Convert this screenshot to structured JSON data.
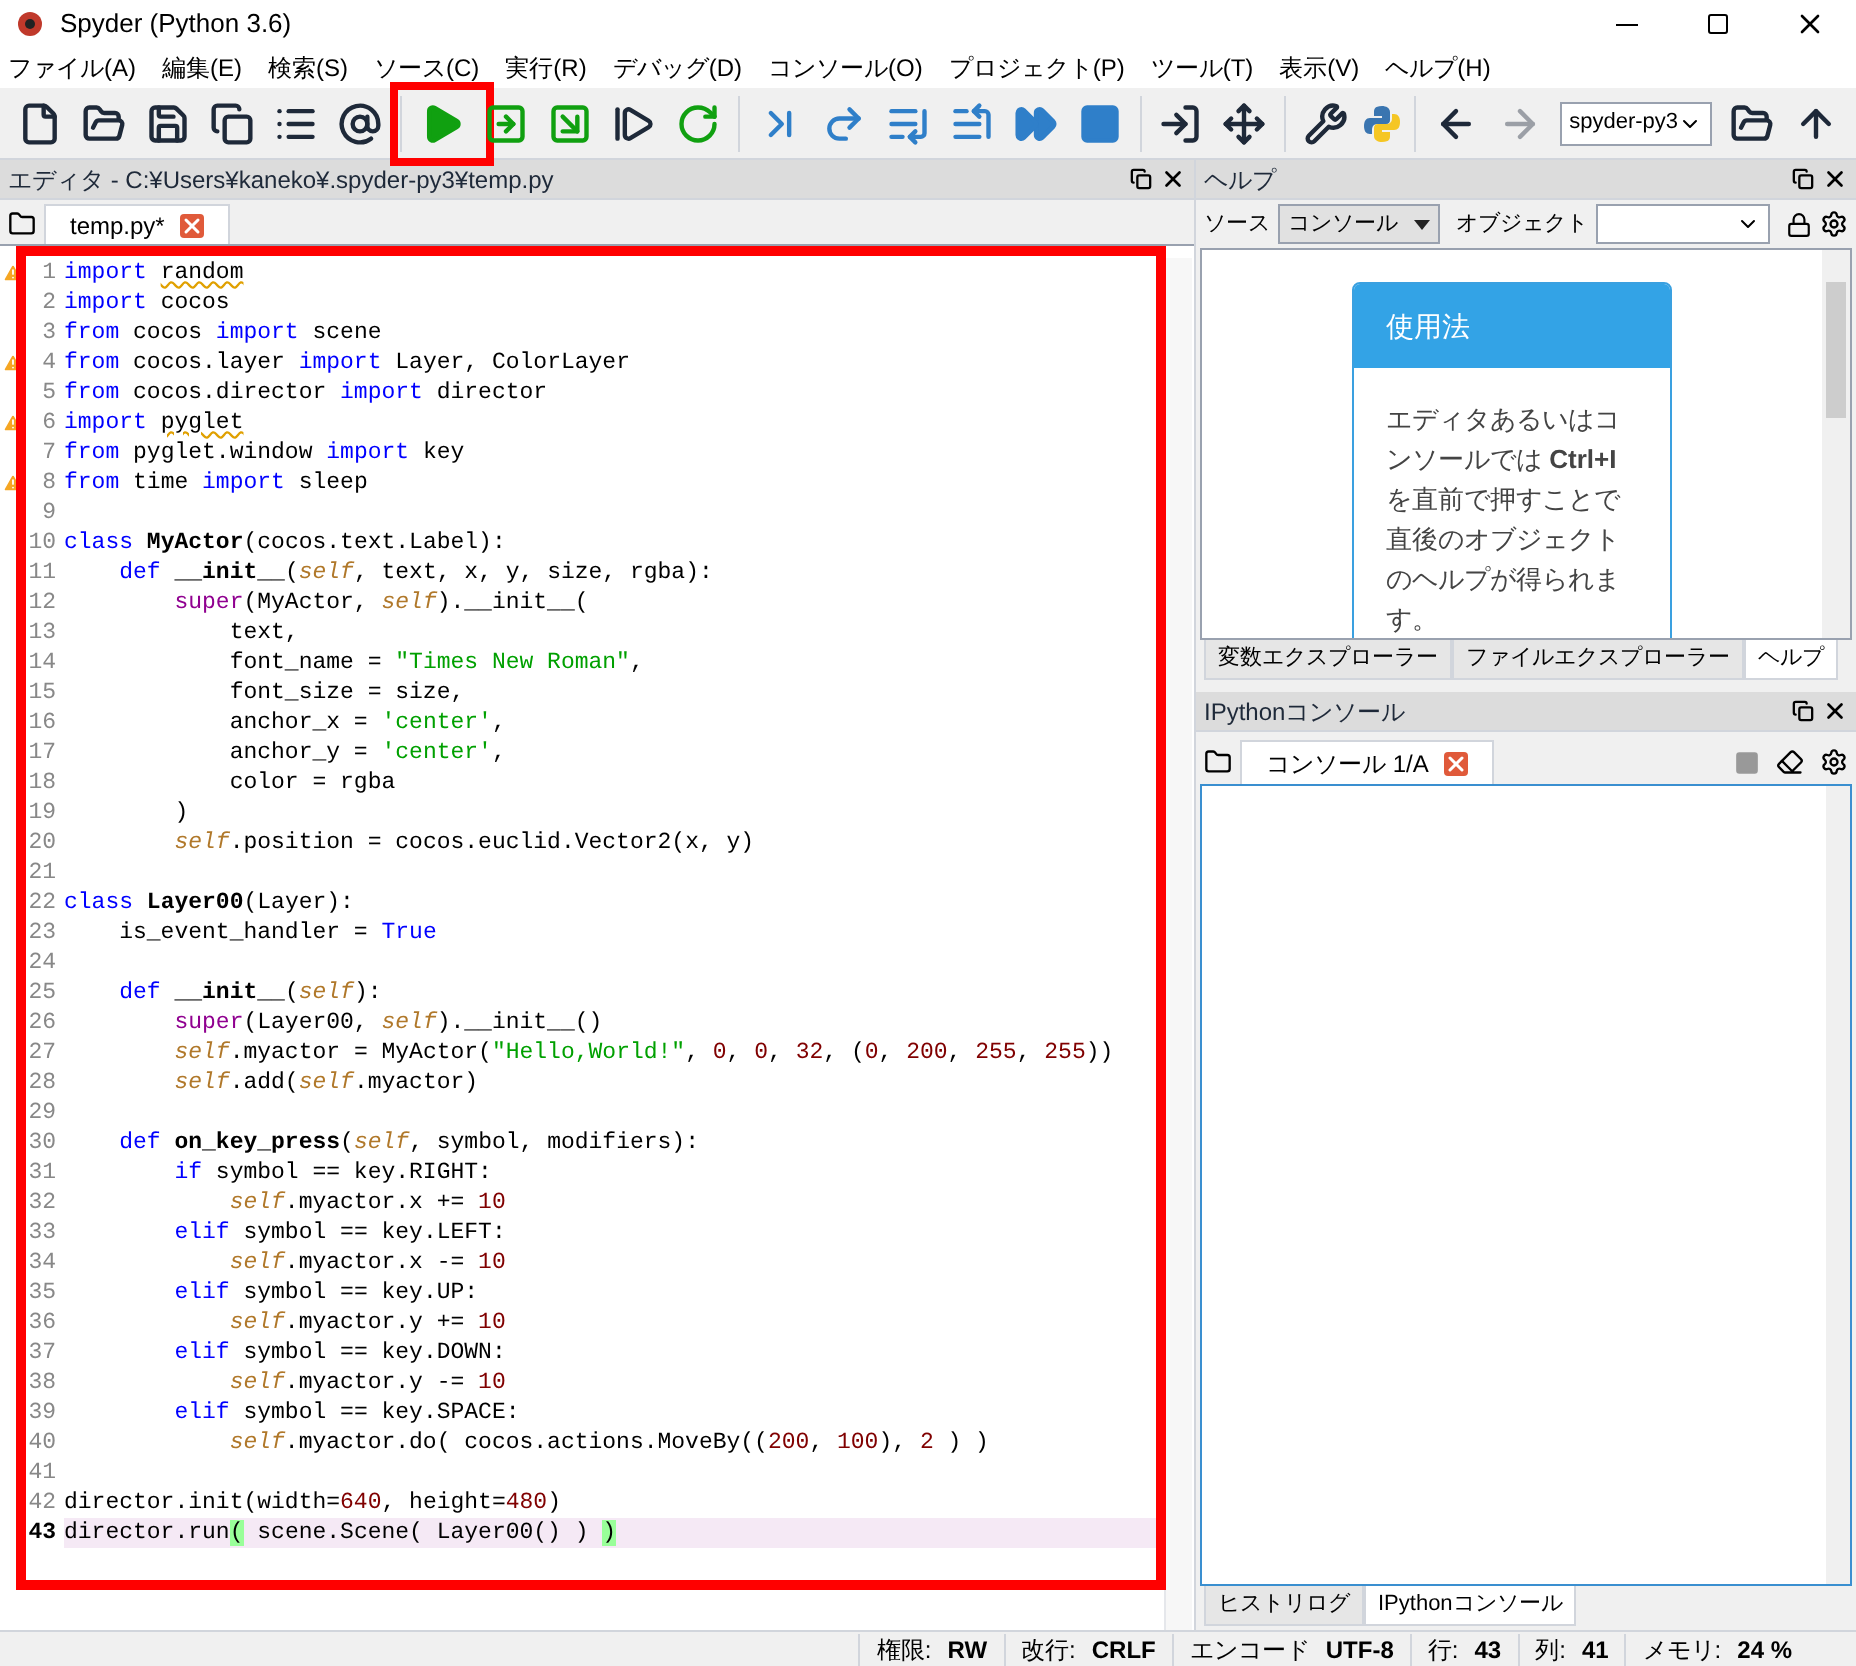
{
  "window": {
    "title": "Spyder (Python 3.6)"
  },
  "menu": [
    "ファイル(A)",
    "編集(E)",
    "検索(S)",
    "ソース(C)",
    "実行(R)",
    "デバッグ(D)",
    "コンソール(O)",
    "プロジェクト(P)",
    "ツール(T)",
    "表示(V)",
    "ヘルプ(H)"
  ],
  "toolbar": [
    {
      "kind": "new"
    },
    {
      "kind": "open"
    },
    {
      "kind": "save"
    },
    {
      "kind": "saveall"
    },
    {
      "kind": "outline"
    },
    {
      "kind": "at"
    },
    {
      "kind": "separator"
    },
    {
      "kind": "run",
      "highlighted": true
    },
    {
      "kind": "runcell"
    },
    {
      "kind": "runcelladvance"
    },
    {
      "kind": "runselection"
    },
    {
      "kind": "rerun"
    },
    {
      "kind": "separator"
    },
    {
      "kind": "debug"
    },
    {
      "kind": "step"
    },
    {
      "kind": "stepinto"
    },
    {
      "kind": "stepreturn"
    },
    {
      "kind": "continue"
    },
    {
      "kind": "stop"
    },
    {
      "kind": "separator"
    },
    {
      "kind": "maximize"
    },
    {
      "kind": "fullscreen"
    },
    {
      "kind": "separator"
    },
    {
      "kind": "preferences"
    },
    {
      "kind": "python"
    },
    {
      "kind": "separator"
    },
    {
      "kind": "back"
    },
    {
      "kind": "forward",
      "disabled": true
    },
    {
      "kind": "path",
      "value": "spyder-py3"
    },
    {
      "kind": "browse"
    },
    {
      "kind": "up"
    }
  ],
  "editor": {
    "title": "エディタ - C:¥Users¥kaneko¥.spyder-py3¥temp.py",
    "highlighted": true,
    "tabs": [
      {
        "label": "temp.py*",
        "selected": true
      }
    ],
    "lines": [
      {
        "n": "1",
        "warning": true,
        "tokens": [
          {
            "kind": "keyword",
            "text": "import "
          },
          {
            "kind": "unused",
            "text": "random"
          }
        ]
      },
      {
        "n": "2",
        "tokens": [
          {
            "kind": "keyword",
            "text": "import"
          },
          {
            "kind": "plain",
            "text": " cocos"
          }
        ]
      },
      {
        "n": "3",
        "tokens": [
          {
            "kind": "keyword",
            "text": "from"
          },
          {
            "kind": "plain",
            "text": " cocos "
          },
          {
            "kind": "keyword",
            "text": "import"
          },
          {
            "kind": "plain",
            "text": " scene"
          }
        ]
      },
      {
        "n": "4",
        "warning": true,
        "tokens": [
          {
            "kind": "keyword",
            "text": "from"
          },
          {
            "kind": "plain",
            "text": " cocos.layer "
          },
          {
            "kind": "keyword",
            "text": "import"
          },
          {
            "kind": "plain",
            "text": " Layer, ColorLayer"
          }
        ]
      },
      {
        "n": "5",
        "tokens": [
          {
            "kind": "keyword",
            "text": "from"
          },
          {
            "kind": "plain",
            "text": " cocos.director "
          },
          {
            "kind": "keyword",
            "text": "import"
          },
          {
            "kind": "plain",
            "text": " director"
          }
        ]
      },
      {
        "n": "6",
        "warning": true,
        "tokens": [
          {
            "kind": "keyword",
            "text": "import "
          },
          {
            "kind": "unused",
            "text": "pyglet"
          }
        ]
      },
      {
        "n": "7",
        "tokens": [
          {
            "kind": "keyword",
            "text": "from"
          },
          {
            "kind": "plain",
            "text": " pyglet.window "
          },
          {
            "kind": "keyword",
            "text": "import"
          },
          {
            "kind": "plain",
            "text": " key"
          }
        ]
      },
      {
        "n": "8",
        "warning": true,
        "tokens": [
          {
            "kind": "keyword",
            "text": "from"
          },
          {
            "kind": "plain",
            "text": " time "
          },
          {
            "kind": "keyword",
            "text": "import"
          },
          {
            "kind": "plain",
            "text": " sleep"
          }
        ]
      },
      {
        "n": "9"
      },
      {
        "n": "10",
        "tokens": [
          {
            "kind": "keyword",
            "text": "class "
          },
          {
            "kind": "name",
            "text": "MyActor"
          },
          {
            "kind": "plain",
            "text": "(cocos.text.Label):"
          }
        ]
      },
      {
        "n": "11",
        "tokens": [
          {
            "kind": "keyword",
            "text": "    def "
          },
          {
            "kind": "name",
            "text": "__init__"
          },
          {
            "kind": "plain",
            "text": "("
          },
          {
            "kind": "self",
            "text": "self"
          },
          {
            "kind": "plain",
            "text": ", text, x, y, size, rgba):"
          }
        ]
      },
      {
        "n": "12",
        "tokens": [
          {
            "kind": "builtin",
            "text": "        super"
          },
          {
            "kind": "plain",
            "text": "(MyActor, "
          },
          {
            "kind": "self",
            "text": "self"
          },
          {
            "kind": "plain",
            "text": ").__init__("
          }
        ]
      },
      {
        "n": "13",
        "tokens": [
          {
            "kind": "plain",
            "text": "            text,"
          }
        ]
      },
      {
        "n": "14",
        "tokens": [
          {
            "kind": "plain",
            "text": "            font_name = "
          },
          {
            "kind": "string",
            "text": "\"Times New Roman\""
          },
          {
            "kind": "plain",
            "text": ","
          }
        ]
      },
      {
        "n": "15",
        "tokens": [
          {
            "kind": "plain",
            "text": "            font_size = size,"
          }
        ]
      },
      {
        "n": "16",
        "tokens": [
          {
            "kind": "plain",
            "text": "            anchor_x = "
          },
          {
            "kind": "string",
            "text": "'center'"
          },
          {
            "kind": "plain",
            "text": ","
          }
        ]
      },
      {
        "n": "17",
        "tokens": [
          {
            "kind": "plain",
            "text": "            anchor_y = "
          },
          {
            "kind": "string",
            "text": "'center'"
          },
          {
            "kind": "plain",
            "text": ","
          }
        ]
      },
      {
        "n": "18",
        "tokens": [
          {
            "kind": "plain",
            "text": "            color = rgba"
          }
        ]
      },
      {
        "n": "19",
        "tokens": [
          {
            "kind": "plain",
            "text": "        )"
          }
        ]
      },
      {
        "n": "20",
        "tokens": [
          {
            "kind": "self",
            "text": "        self"
          },
          {
            "kind": "plain",
            "text": ".position = cocos.euclid.Vector2(x, y)"
          }
        ]
      },
      {
        "n": "21"
      },
      {
        "n": "22",
        "tokens": [
          {
            "kind": "keyword",
            "text": "class "
          },
          {
            "kind": "name",
            "text": "Layer00"
          },
          {
            "kind": "plain",
            "text": "(Layer):"
          }
        ]
      },
      {
        "n": "23",
        "tokens": [
          {
            "kind": "plain",
            "text": "    is_event_handler = "
          },
          {
            "kind": "keyword",
            "text": "True"
          }
        ]
      },
      {
        "n": "24"
      },
      {
        "n": "25",
        "tokens": [
          {
            "kind": "keyword",
            "text": "    def "
          },
          {
            "kind": "name",
            "text": "__init__"
          },
          {
            "kind": "plain",
            "text": "("
          },
          {
            "kind": "self",
            "text": "self"
          },
          {
            "kind": "plain",
            "text": "):"
          }
        ]
      },
      {
        "n": "26",
        "tokens": [
          {
            "kind": "builtin",
            "text": "        super"
          },
          {
            "kind": "plain",
            "text": "(Layer00, "
          },
          {
            "kind": "self",
            "text": "self"
          },
          {
            "kind": "plain",
            "text": ").__init__()"
          }
        ]
      },
      {
        "n": "27",
        "tokens": [
          {
            "kind": "self",
            "text": "        self"
          },
          {
            "kind": "plain",
            "text": ".myactor = MyActor("
          },
          {
            "kind": "string",
            "text": "\"Hello,World!\""
          },
          {
            "kind": "plain",
            "text": ", "
          },
          {
            "kind": "number",
            "text": "0"
          },
          {
            "kind": "plain",
            "text": ", "
          },
          {
            "kind": "number",
            "text": "0"
          },
          {
            "kind": "plain",
            "text": ", "
          },
          {
            "kind": "number",
            "text": "32"
          },
          {
            "kind": "plain",
            "text": ", ("
          },
          {
            "kind": "number",
            "text": "0"
          },
          {
            "kind": "plain",
            "text": ", "
          },
          {
            "kind": "number",
            "text": "200"
          },
          {
            "kind": "plain",
            "text": ", "
          },
          {
            "kind": "number",
            "text": "255"
          },
          {
            "kind": "plain",
            "text": ", "
          },
          {
            "kind": "number",
            "text": "255"
          },
          {
            "kind": "plain",
            "text": "))"
          }
        ]
      },
      {
        "n": "28",
        "tokens": [
          {
            "kind": "self",
            "text": "        self"
          },
          {
            "kind": "plain",
            "text": ".add("
          },
          {
            "kind": "self",
            "text": "self"
          },
          {
            "kind": "plain",
            "text": ".myactor)"
          }
        ]
      },
      {
        "n": "29"
      },
      {
        "n": "30",
        "tokens": [
          {
            "kind": "keyword",
            "text": "    def "
          },
          {
            "kind": "name",
            "text": "on_key_press"
          },
          {
            "kind": "plain",
            "text": "("
          },
          {
            "kind": "self",
            "text": "self"
          },
          {
            "kind": "plain",
            "text": ", symbol, modifiers):"
          }
        ]
      },
      {
        "n": "31",
        "tokens": [
          {
            "kind": "keyword",
            "text": "        if"
          },
          {
            "kind": "plain",
            "text": " symbol == key.RIGHT:"
          }
        ]
      },
      {
        "n": "32",
        "tokens": [
          {
            "kind": "self",
            "text": "            self"
          },
          {
            "kind": "plain",
            "text": ".myactor.x += "
          },
          {
            "kind": "number",
            "text": "10"
          }
        ]
      },
      {
        "n": "33",
        "tokens": [
          {
            "kind": "keyword",
            "text": "        elif"
          },
          {
            "kind": "plain",
            "text": " symbol == key.LEFT:"
          }
        ]
      },
      {
        "n": "34",
        "tokens": [
          {
            "kind": "self",
            "text": "            self"
          },
          {
            "kind": "plain",
            "text": ".myactor.x -= "
          },
          {
            "kind": "number",
            "text": "10"
          }
        ]
      },
      {
        "n": "35",
        "tokens": [
          {
            "kind": "keyword",
            "text": "        elif"
          },
          {
            "kind": "plain",
            "text": " symbol == key.UP:"
          }
        ]
      },
      {
        "n": "36",
        "tokens": [
          {
            "kind": "self",
            "text": "            self"
          },
          {
            "kind": "plain",
            "text": ".myactor.y += "
          },
          {
            "kind": "number",
            "text": "10"
          }
        ]
      },
      {
        "n": "37",
        "tokens": [
          {
            "kind": "keyword",
            "text": "        elif"
          },
          {
            "kind": "plain",
            "text": " symbol == key.DOWN:"
          }
        ]
      },
      {
        "n": "38",
        "tokens": [
          {
            "kind": "self",
            "text": "            self"
          },
          {
            "kind": "plain",
            "text": ".myactor.y -= "
          },
          {
            "kind": "number",
            "text": "10"
          }
        ]
      },
      {
        "n": "39",
        "tokens": [
          {
            "kind": "keyword",
            "text": "        elif"
          },
          {
            "kind": "plain",
            "text": " symbol == key.SPACE:"
          }
        ]
      },
      {
        "n": "40",
        "tokens": [
          {
            "kind": "self",
            "text": "            self"
          },
          {
            "kind": "plain",
            "text": ".myactor.do( cocos.actions.MoveBy(("
          },
          {
            "kind": "number",
            "text": "200"
          },
          {
            "kind": "plain",
            "text": ", "
          },
          {
            "kind": "number",
            "text": "100"
          },
          {
            "kind": "plain",
            "text": "), "
          },
          {
            "kind": "number",
            "text": "2"
          },
          {
            "kind": "plain",
            "text": " ) )"
          }
        ]
      },
      {
        "n": "41"
      },
      {
        "n": "42",
        "tokens": [
          {
            "kind": "plain",
            "text": "director.init(width="
          },
          {
            "kind": "number",
            "text": "640"
          },
          {
            "kind": "plain",
            "text": ", height="
          },
          {
            "kind": "number",
            "text": "480"
          },
          {
            "kind": "plain",
            "text": ")"
          }
        ]
      },
      {
        "n": "43",
        "current": true,
        "tokens": [
          {
            "kind": "plain",
            "text": "director.run"
          },
          {
            "kind": "match",
            "text": "("
          },
          {
            "kind": "plain",
            "text": " scene.Scene( Layer00() ) "
          },
          {
            "kind": "match",
            "text": ")"
          }
        ]
      }
    ]
  },
  "help": {
    "title": "ヘルプ",
    "source_label": "ソース",
    "source_value": "コンソール",
    "object_label": "オブジェクト",
    "card_title": "使用法",
    "card_text": "エディタあるいはコンソールでは **Ctrl+I** を直前で押すことで直後のオブジェクトのヘルプが得られます。",
    "tabs": [
      {
        "label": "変数エクスプローラー",
        "selected": false
      },
      {
        "label": "ファイルエクスプローラー",
        "selected": false
      },
      {
        "label": "ヘルプ",
        "selected": true
      }
    ]
  },
  "console": {
    "title": "IPythonコンソール",
    "tabs": [
      {
        "label": "コンソール 1/A",
        "selected": true
      }
    ],
    "bottom_tabs": [
      {
        "label": "ヒストリログ",
        "selected": false
      },
      {
        "label": "IPythonコンソール",
        "selected": true
      }
    ]
  },
  "status_bar": [
    {
      "label": "権限:",
      "value": "RW"
    },
    {
      "label": "改行:",
      "value": "CRLF"
    },
    {
      "label": "エンコード",
      "value": "UTF-8"
    },
    {
      "label": "行:",
      "value": "43"
    },
    {
      "label": "列:",
      "value": "41"
    },
    {
      "label": "メモリ:",
      "value": "24 %"
    }
  ]
}
